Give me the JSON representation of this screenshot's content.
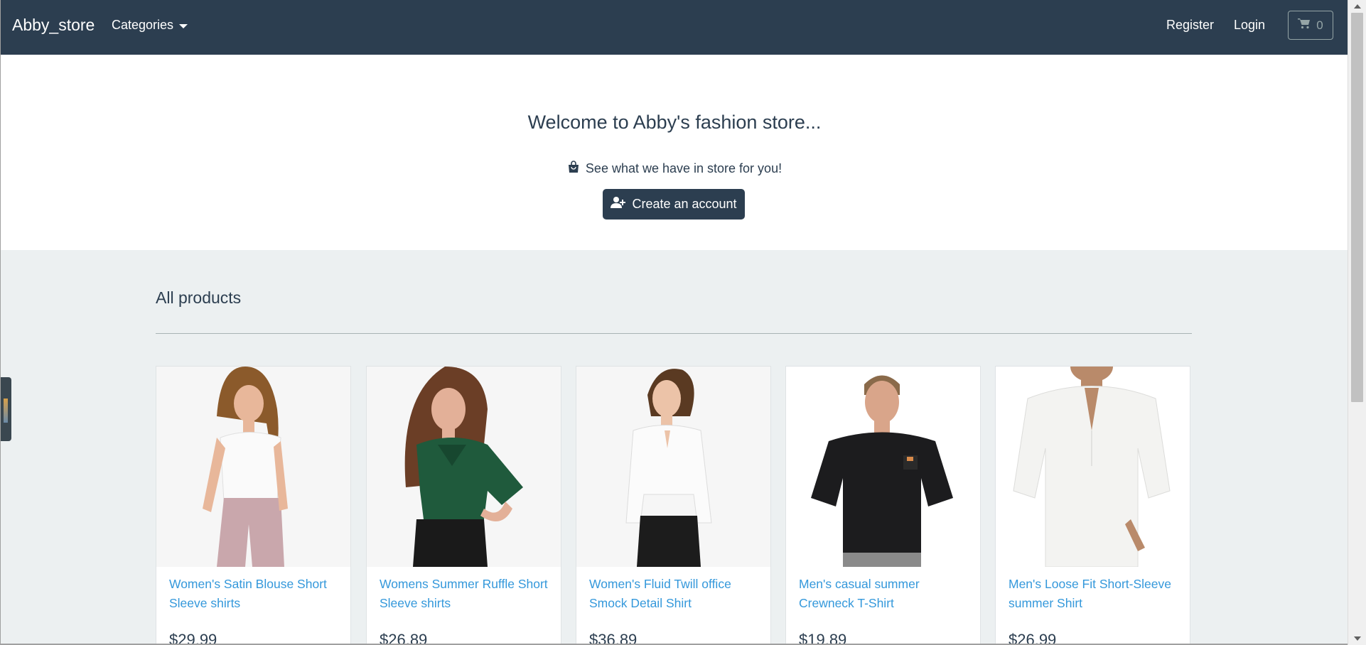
{
  "navbar": {
    "brand": "Abby_store",
    "categories_label": "Categories",
    "register_label": "Register",
    "login_label": "Login",
    "cart_count": "0"
  },
  "hero": {
    "title": "Welcome to Abby's fashion store...",
    "subtitle": "See what we have in store for you!",
    "cta_label": "Create an account"
  },
  "products": {
    "title": "All products",
    "items": [
      {
        "name": "Women's Satin Blouse Short Sleeve shirts",
        "price": "$29.99",
        "icon": "white-blouse-photo"
      },
      {
        "name": "Womens Summer Ruffle Short Sleeve shirts",
        "price": "$26.89",
        "icon": "green-blouse-photo"
      },
      {
        "name": "Women's Fluid Twill office Smock Detail Shirt",
        "price": "$36.89",
        "icon": "white-office-shirt-photo"
      },
      {
        "name": "Men's casual summer Crewneck T-Shirt",
        "price": "$19.89",
        "icon": "black-tshirt-photo"
      },
      {
        "name": "Men's Loose Fit Short-Sleeve summer Shirt",
        "price": "$26.99",
        "icon": "white-linen-shirt-photo"
      }
    ]
  },
  "colors": {
    "primary": "#2c3e50",
    "link": "#3498db",
    "section_bg": "#ecf0f1"
  }
}
